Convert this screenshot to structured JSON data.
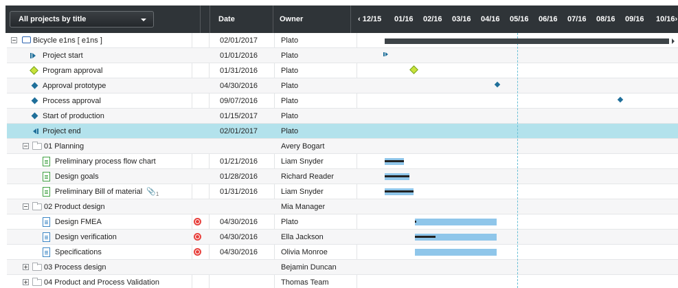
{
  "header": {
    "view_selector": "All projects by title",
    "col_date": "Date",
    "col_owner": "Owner"
  },
  "timeline": {
    "nav_prev": "‹ 12/15",
    "months": [
      "01/16",
      "02/16",
      "03/16",
      "04/16",
      "05/16",
      "06/16",
      "07/16",
      "08/16",
      "09/16"
    ],
    "nav_next": "10/16›"
  },
  "rows": [
    {
      "title": "Bicycle e1ns [ e1ns ]",
      "date": "02/01/2017",
      "owner": "Plato",
      "icon": "project-icon"
    },
    {
      "title": "Project start",
      "date": "01/01/2016",
      "owner": "Plato",
      "icon": "start-milestone-icon"
    },
    {
      "title": "Program approval",
      "date": "01/31/2016",
      "owner": "Plato",
      "icon": "approval-milestone-icon"
    },
    {
      "title": "Approval prototype",
      "date": "04/30/2016",
      "owner": "Plato",
      "icon": "milestone-icon"
    },
    {
      "title": "Process approval",
      "date": "09/07/2016",
      "owner": "Plato",
      "icon": "milestone-icon"
    },
    {
      "title": "Start of production",
      "date": "01/15/2017",
      "owner": "Plato",
      "icon": "milestone-icon"
    },
    {
      "title": "Project end",
      "date": "02/01/2017",
      "owner": "Plato",
      "icon": "end-milestone-icon"
    },
    {
      "title": "01 Planning",
      "date": "",
      "owner": "Avery Bogart",
      "icon": "folder-icon"
    },
    {
      "title": "Preliminary process flow chart",
      "date": "01/21/2016",
      "owner": "Liam Snyder",
      "icon": "task-doc-icon"
    },
    {
      "title": "Design goals",
      "date": "01/28/2016",
      "owner": "Richard Reader",
      "icon": "task-doc-icon"
    },
    {
      "title": "Preliminary Bill of material",
      "date": "01/31/2016",
      "owner": "Liam Snyder",
      "icon": "task-doc-icon",
      "attachments": "1"
    },
    {
      "title": "02 Product design",
      "date": "",
      "owner": "Mia Manager",
      "icon": "folder-icon"
    },
    {
      "title": "Design FMEA",
      "date": "04/30/2016",
      "owner": "Plato",
      "icon": "fmea-doc-icon"
    },
    {
      "title": "Design verification",
      "date": "04/30/2016",
      "owner": "Ella Jackson",
      "icon": "fmea-doc-icon"
    },
    {
      "title": "Specifications",
      "date": "04/30/2016",
      "owner": "Olivia Monroe",
      "icon": "spec-doc-icon"
    },
    {
      "title": "03 Process design",
      "date": "",
      "owner": "Bejamin Duncan",
      "icon": "folder-icon"
    },
    {
      "title": "04 Product and Process Validation",
      "date": "",
      "owner": "Thomas Team",
      "icon": "folder-icon"
    }
  ],
  "colors": {
    "header_bg": "#2f3438",
    "selected_row": "#b3e2ec",
    "bar_plan": "#8fc6ea",
    "summary_bar": "#3d4347",
    "milestone": "#1f6f9a",
    "approval": "#c9e23b",
    "flag": "#e8413d"
  }
}
